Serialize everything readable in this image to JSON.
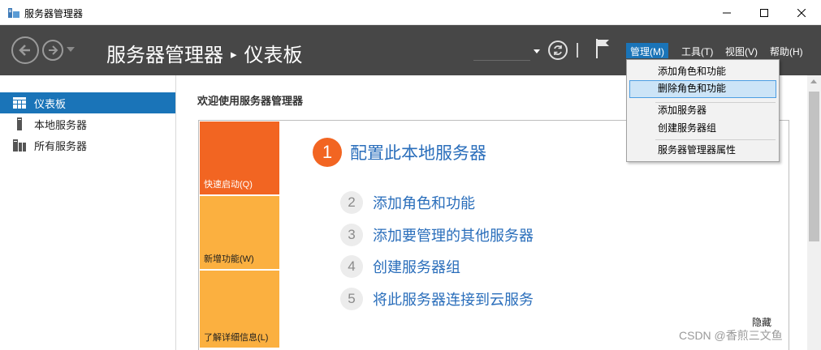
{
  "window": {
    "title": "服务器管理器"
  },
  "header": {
    "breadcrumb_root": "服务器管理器",
    "breadcrumb_sep": "▸",
    "breadcrumb_current": "仪表板",
    "menu": {
      "manage": "管理(M)",
      "tools": "工具(T)",
      "view": "视图(V)",
      "help": "帮助(H)"
    }
  },
  "sidebar": {
    "items": [
      {
        "label": "仪表板",
        "icon": "dashboard-icon",
        "selected": true
      },
      {
        "label": "本地服务器",
        "icon": "server-icon",
        "selected": false
      },
      {
        "label": "所有服务器",
        "icon": "servers-icon",
        "selected": false
      }
    ]
  },
  "main": {
    "welcome": "欢迎使用服务器管理器",
    "tiles": {
      "quick_start": "快速启动(Q)",
      "whats_new": "新增功能(W)",
      "learn_more": "了解详细信息(L)"
    },
    "steps": [
      {
        "num": "1",
        "label": "配置此本地服务器"
      },
      {
        "num": "2",
        "label": "添加角色和功能"
      },
      {
        "num": "3",
        "label": "添加要管理的其他服务器"
      },
      {
        "num": "4",
        "label": "创建服务器组"
      },
      {
        "num": "5",
        "label": "将此服务器连接到云服务"
      }
    ],
    "hide": "隐藏"
  },
  "manage_menu": {
    "items": [
      "添加角色和功能",
      "删除角色和功能",
      "添加服务器",
      "创建服务器组",
      "服务器管理器属性"
    ]
  },
  "watermark": "CSDN @香煎三文鱼",
  "colors": {
    "header_bg": "#474747",
    "accent_blue": "#1a74b8",
    "tile_orange": "#f26522",
    "tile_amber": "#fbb040",
    "link_blue": "#2a6ebb"
  }
}
